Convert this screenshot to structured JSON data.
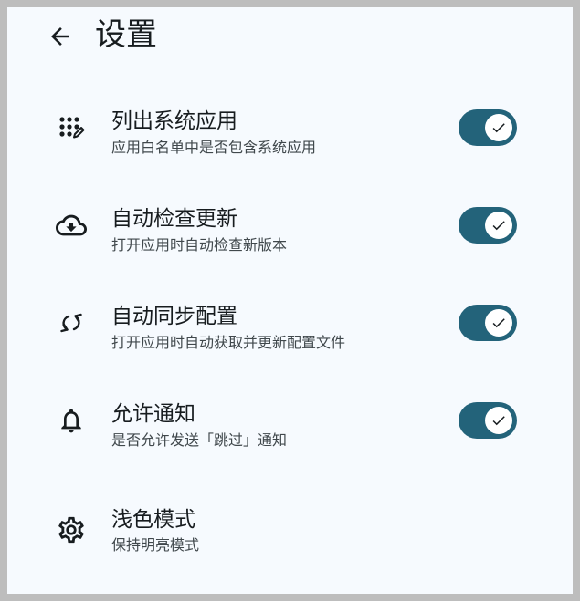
{
  "header": {
    "title": "设置",
    "back_icon": "arrow-back-icon"
  },
  "settings": [
    {
      "id": "list-system-apps",
      "icon": "apps-edit-icon",
      "title": "列出系统应用",
      "subtitle": "应用白名单中是否包含系统应用",
      "toggle": true
    },
    {
      "id": "auto-check-update",
      "icon": "cloud-download-icon",
      "title": "自动检查更新",
      "subtitle": "打开应用时自动检查新版本",
      "toggle": true
    },
    {
      "id": "auto-sync-config",
      "icon": "sync-icon",
      "title": "自动同步配置",
      "subtitle": "打开应用时自动获取并更新配置文件",
      "toggle": true
    },
    {
      "id": "allow-notifications",
      "icon": "bell-icon",
      "title": "允许通知",
      "subtitle": "是否允许发送「跳过」通知",
      "toggle": true
    },
    {
      "id": "light-mode",
      "icon": "gear-icon",
      "title": "浅色模式",
      "subtitle": "保持明亮模式"
    }
  ],
  "colors": {
    "background": "#f6fafe",
    "accent": "#23637a",
    "text_primary": "#171c1f",
    "text_secondary": "#40484c"
  }
}
